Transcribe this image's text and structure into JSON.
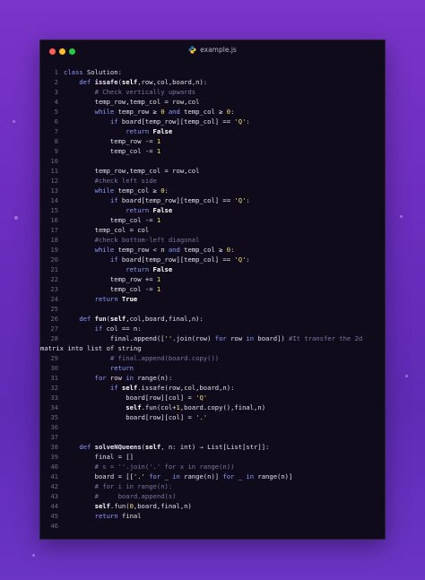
{
  "window": {
    "filename": "example.js",
    "colors": {
      "close": "#ff5f57",
      "minimize": "#febc2e",
      "maximize": "#28c840",
      "background": "#0f0b1a",
      "keyword": "#8d9bff",
      "string": "#f2e27a",
      "comment": "#7b76a3"
    }
  },
  "code": {
    "lines": [
      {
        "n": "1",
        "t": "class Solution:"
      },
      {
        "n": "2",
        "t": "    def issafe(self,row,col,board,n):"
      },
      {
        "n": "3",
        "t": "        # Check vertically upwards"
      },
      {
        "n": "4",
        "t": "        temp_row,temp_col = row,col"
      },
      {
        "n": "5",
        "t": "        while temp_row ≥ 0 and temp_col ≥ 0:"
      },
      {
        "n": "6",
        "t": "            if board[temp_row][temp_col] == 'Q':"
      },
      {
        "n": "7",
        "t": "                return False"
      },
      {
        "n": "8",
        "t": "            temp_row -= 1"
      },
      {
        "n": "9",
        "t": "            temp_col -= 1"
      },
      {
        "n": "10",
        "t": ""
      },
      {
        "n": "11",
        "t": "        temp_row,temp_col = row,col"
      },
      {
        "n": "12",
        "t": "        #check left side"
      },
      {
        "n": "13",
        "t": "        while temp_col ≥ 0:"
      },
      {
        "n": "14",
        "t": "            if board[temp_row][temp_col] == 'Q':"
      },
      {
        "n": "15",
        "t": "                return False"
      },
      {
        "n": "16",
        "t": "            temp_col -= 1"
      },
      {
        "n": "17",
        "t": "        temp_col = col"
      },
      {
        "n": "18",
        "t": "        #check bottom-left diagonal"
      },
      {
        "n": "19",
        "t": "        while temp_row < n and temp_col ≥ 0:"
      },
      {
        "n": "20",
        "t": "            if board[temp_row][temp_col] == 'Q':"
      },
      {
        "n": "21",
        "t": "                return False"
      },
      {
        "n": "22",
        "t": "            temp_row += 1"
      },
      {
        "n": "23",
        "t": "            temp_col -= 1"
      },
      {
        "n": "24",
        "t": "        return True"
      },
      {
        "n": "25",
        "t": ""
      },
      {
        "n": "26",
        "t": "    def fun(self,col,board,final,n):"
      },
      {
        "n": "27",
        "t": "        if col == n:"
      },
      {
        "n": "28",
        "t": "            final.append([''.join(row) for row in board]) #It transfer the 2d"
      },
      {
        "n": "",
        "t": "matrix into list of string"
      },
      {
        "n": "29",
        "t": "            # final.append(board.copy())"
      },
      {
        "n": "30",
        "t": "            return"
      },
      {
        "n": "31",
        "t": "        for row in range(n):"
      },
      {
        "n": "32",
        "t": "            if self.issafe(row,col,board,n):"
      },
      {
        "n": "33",
        "t": "                board[row][col] = 'Q'"
      },
      {
        "n": "34",
        "t": "                self.fun(col+1,board.copy(),final,n)"
      },
      {
        "n": "35",
        "t": "                board[row][col] = '.'"
      },
      {
        "n": "36",
        "t": ""
      },
      {
        "n": "37",
        "t": ""
      },
      {
        "n": "38",
        "t": "    def solveNQueens(self, n: int) → List[List[str]]:"
      },
      {
        "n": "39",
        "t": "        final = []"
      },
      {
        "n": "40",
        "t": "        # s = ''.join('.' for x in range(n))"
      },
      {
        "n": "41",
        "t": "        board = [['.' for _ in range(n)] for _ in range(n)]"
      },
      {
        "n": "42",
        "t": "        # for i in range(n):"
      },
      {
        "n": "43",
        "t": "        #     board.append(s)"
      },
      {
        "n": "44",
        "t": "        self.fun(0,board,final,n)"
      },
      {
        "n": "45",
        "t": "        return final"
      },
      {
        "n": "46",
        "t": ""
      }
    ]
  }
}
